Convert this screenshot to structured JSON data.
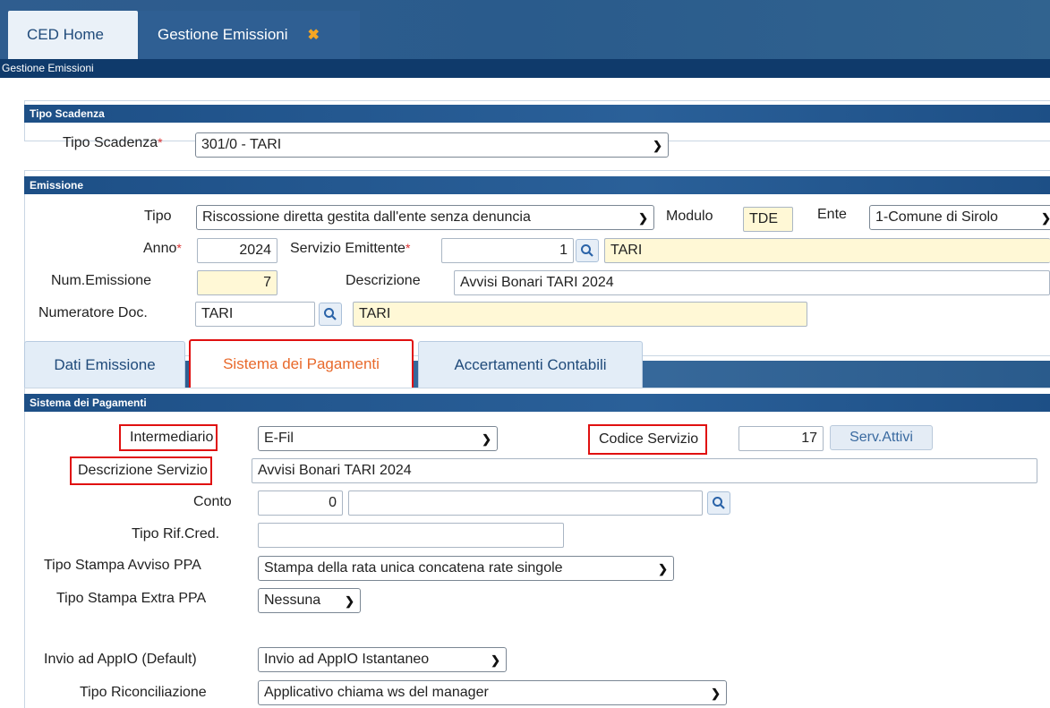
{
  "tabs": {
    "home": "CED Home",
    "active": "Gestione Emissioni",
    "close_glyph": "✖"
  },
  "breadcrumb": "Gestione Emissioni",
  "tipo_scadenza": {
    "header": "Tipo Scadenza",
    "label": "Tipo Scadenza",
    "value": "301/0 - TARI"
  },
  "emissione": {
    "header": "Emissione",
    "tipo_label": "Tipo",
    "tipo_value": "Riscossione diretta gestita dall'ente senza denuncia",
    "modulo_label": "Modulo",
    "modulo_value": "TDE",
    "ente_label": "Ente",
    "ente_value": "1-Comune di Sirolo",
    "anno_label": "Anno",
    "anno_value": "2024",
    "servizio_label": "Servizio Emittente",
    "servizio_code": "1",
    "servizio_desc": "TARI",
    "num_label": "Num.Emissione",
    "num_value": "7",
    "descr_label": "Descrizione",
    "descr_value": "Avvisi Bonari TARI 2024",
    "numeratore_label": "Numeratore Doc.",
    "numeratore_code": "TARI",
    "numeratore_desc": "TARI"
  },
  "inner_tabs": [
    "Dati Emissione",
    "Sistema dei Pagamenti",
    "Accertamenti Contabili"
  ],
  "pagamenti": {
    "header": "Sistema dei Pagamenti",
    "intermediario_label": "Intermediario",
    "intermediario_value": "E-Fil",
    "codice_label": "Codice Servizio",
    "codice_value": "17",
    "serv_attivi": "Serv.Attivi",
    "descr_servizio_label": "Descrizione Servizio",
    "descr_servizio_value": "Avvisi Bonari TARI 2024",
    "conto_label": "Conto",
    "conto_value": "0",
    "conto_desc": "",
    "rifcred_label": "Tipo Rif.Cred.",
    "rifcred_value": "",
    "stampa_ppa_label": "Tipo Stampa Avviso PPA",
    "stampa_ppa_value": "Stampa della rata unica concatena rate singole",
    "stampa_extra_label": "Tipo Stampa Extra PPA",
    "stampa_extra_value": "Nessuna",
    "appio_label": "Invio ad AppIO (Default)",
    "appio_value": "Invio ad AppIO Istantaneo",
    "riconc_label": "Tipo Riconciliazione",
    "riconc_value": "Applicativo chiama ws del manager"
  }
}
